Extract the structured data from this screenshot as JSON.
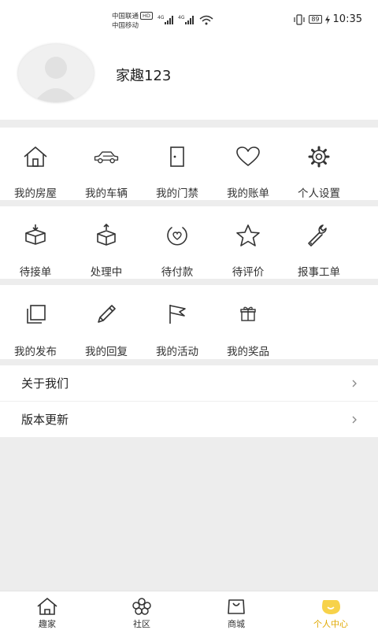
{
  "status_bar": {
    "carrier1": "中国联通",
    "carrier1_badge": "HD",
    "carrier2": "中国移动",
    "network1": "4G",
    "network2": "4G",
    "battery": "89",
    "time": "10:35"
  },
  "profile": {
    "username": "家趣123"
  },
  "section_home": [
    {
      "label": "我的房屋",
      "icon": "house-icon"
    },
    {
      "label": "我的车辆",
      "icon": "car-icon"
    },
    {
      "label": "我的门禁",
      "icon": "door-icon"
    },
    {
      "label": "我的账单",
      "icon": "heart-icon"
    },
    {
      "label": "个人设置",
      "icon": "gear-icon"
    }
  ],
  "section_orders": [
    {
      "label": "待接单",
      "icon": "box-down-icon"
    },
    {
      "label": "处理中",
      "icon": "box-up-icon"
    },
    {
      "label": "待付款",
      "icon": "payment-icon"
    },
    {
      "label": "待评价",
      "icon": "star-icon"
    },
    {
      "label": "报事工单",
      "icon": "wrench-icon"
    }
  ],
  "section_activity": [
    {
      "label": "我的发布",
      "icon": "publish-icon"
    },
    {
      "label": "我的回复",
      "icon": "pencil-icon"
    },
    {
      "label": "我的活动",
      "icon": "flag-icon"
    },
    {
      "label": "我的奖品",
      "icon": "gift-icon"
    }
  ],
  "list": [
    {
      "label": "关于我们"
    },
    {
      "label": "版本更新"
    }
  ],
  "tabbar": [
    {
      "label": "趣家",
      "icon": "home-tab-icon"
    },
    {
      "label": "社区",
      "icon": "community-tab-icon"
    },
    {
      "label": "商城",
      "icon": "shop-tab-icon"
    },
    {
      "label": "个人中心",
      "icon": "profile-tab-icon"
    }
  ],
  "colors": {
    "accent": "#e0a800",
    "accent_light": "#f7d24a",
    "background": "#ededed"
  }
}
